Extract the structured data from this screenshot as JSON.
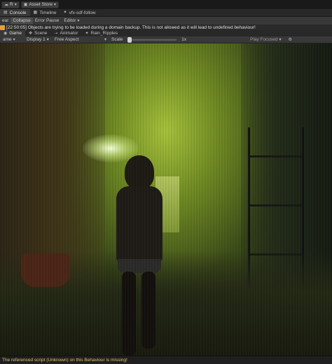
{
  "topbar": {
    "account_badge": "R",
    "asset_store_label": "Asset Store"
  },
  "tabs_row1": [
    {
      "label": "Console",
      "icon": "console-icon"
    },
    {
      "label": "Timeline",
      "icon": "timeline-icon"
    },
    {
      "label": "vfx-sdf-follow",
      "icon": "vfx-graph-icon"
    }
  ],
  "console_toolbar": {
    "clear_label": "ear",
    "collapse_label": "Collapse",
    "error_pause_label": "Error Pause",
    "editor_label": "Editor"
  },
  "console_message": "[22:50:05] Objects are trying to be loaded during a domain backup. This is not allowed as it will lead to undefined behaviour!",
  "tabs_row2": [
    {
      "label": "Game",
      "icon": "game-icon"
    },
    {
      "label": "Scene",
      "icon": "scene-icon"
    },
    {
      "label": "Animator",
      "icon": "animator-icon"
    },
    {
      "label": "Rain_Ripples",
      "icon": "vfx-graph-icon"
    }
  ],
  "game_toolbar": {
    "mode_label": "ame",
    "display_label": "Display 1",
    "aspect_label": "Free Aspect",
    "scale_label": "Scale",
    "scale_value": "1x",
    "play_label": "Play Focused"
  },
  "status_message": "The referenced script (Unknown) on this Behaviour is missing!",
  "colors": {
    "warning": "#e5a13a",
    "status_text": "#e8c268",
    "active_tab": "#383838"
  }
}
